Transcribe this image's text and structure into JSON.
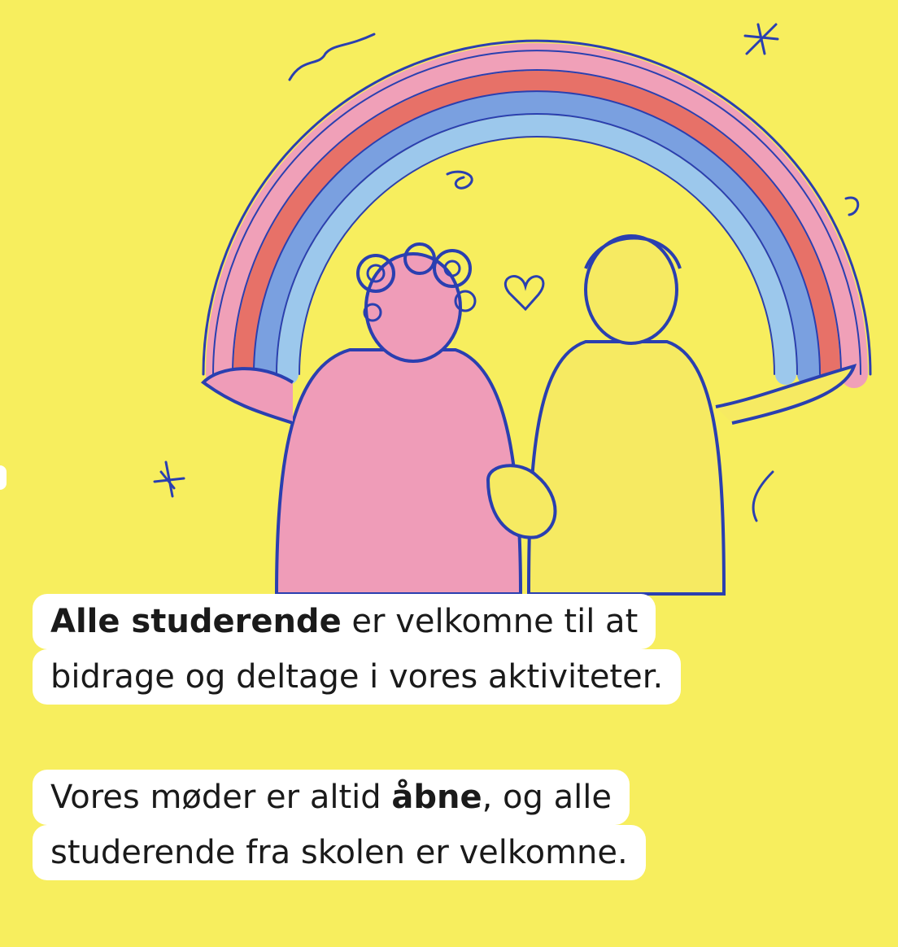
{
  "colors": {
    "background": "#f7ee5e",
    "rainbow_pink": "#f0a0b8",
    "rainbow_red": "#e45a6a",
    "rainbow_blue": "#7aa0e0",
    "rainbow_light_blue": "#9cc8ec",
    "line_blue": "#2a3fb0",
    "figure_pink": "#ef9cb8",
    "figure_yellow": "#f6ea62",
    "text_box": "#ffffff",
    "text": "#1a1a1a"
  },
  "box1": {
    "bold": "Alle studerende",
    "line1_rest": " er velkomne til at",
    "line2": "bidrage og deltage i vores aktiviteter."
  },
  "box2": {
    "line1_pre": "Vores møder er altid ",
    "bold": "åbne",
    "line1_post": ", og alle",
    "line2": "studerende fra skolen er velkomne."
  }
}
